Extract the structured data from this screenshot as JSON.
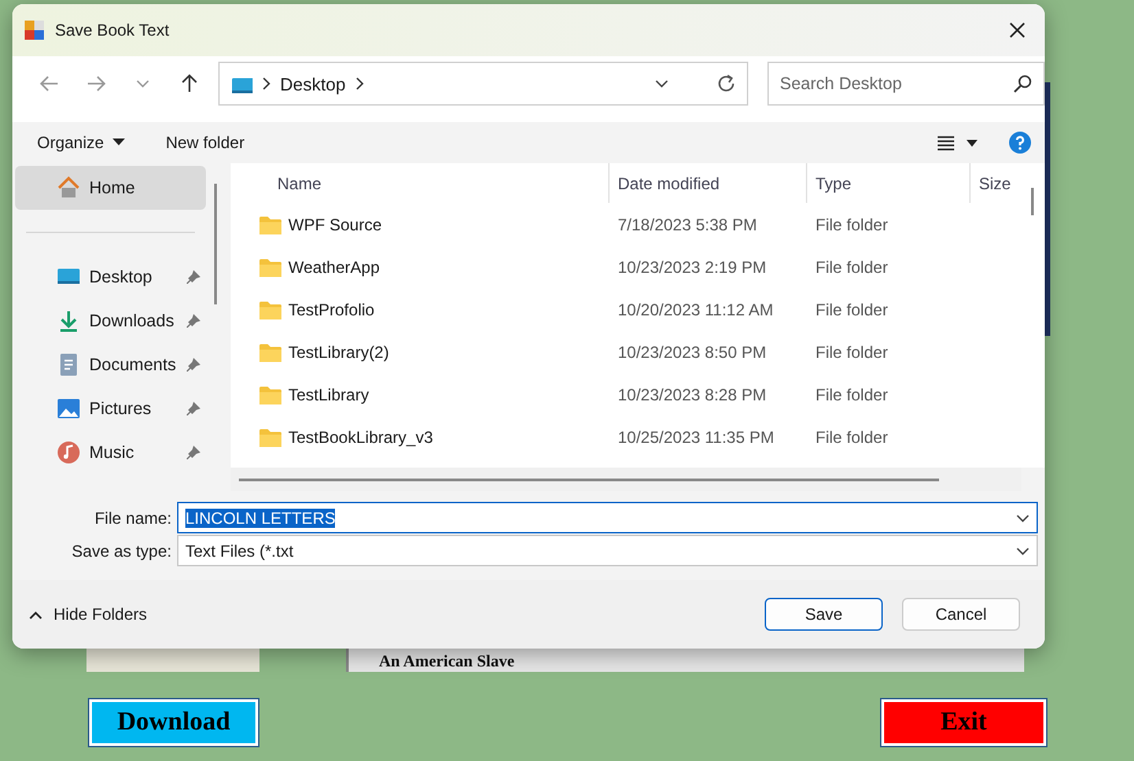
{
  "window": {
    "title": "Save Book Text"
  },
  "address": {
    "path": [
      "Desktop"
    ]
  },
  "search": {
    "placeholder": "Search Desktop"
  },
  "toolbar": {
    "organize": "Organize",
    "new_folder": "New folder"
  },
  "sidebar": {
    "items": [
      {
        "label": "Home",
        "kind": "home",
        "pinned": false,
        "selected": true
      },
      {
        "label": "Desktop",
        "kind": "desktop",
        "pinned": true,
        "selected": false
      },
      {
        "label": "Downloads",
        "kind": "downloads",
        "pinned": true,
        "selected": false
      },
      {
        "label": "Documents",
        "kind": "documents",
        "pinned": true,
        "selected": false
      },
      {
        "label": "Pictures",
        "kind": "pictures",
        "pinned": true,
        "selected": false
      },
      {
        "label": "Music",
        "kind": "music",
        "pinned": true,
        "selected": false
      }
    ]
  },
  "table": {
    "columns": [
      "Name",
      "Date modified",
      "Type",
      "Size"
    ],
    "rows": [
      {
        "name": "WPF Source",
        "date": "7/18/2023 5:38 PM",
        "type": "File folder"
      },
      {
        "name": "WeatherApp",
        "date": "10/23/2023 2:19 PM",
        "type": "File folder"
      },
      {
        "name": "TestProfolio",
        "date": "10/20/2023 11:12 AM",
        "type": "File folder"
      },
      {
        "name": "TestLibrary(2)",
        "date": "10/23/2023 8:50 PM",
        "type": "File folder"
      },
      {
        "name": "TestLibrary",
        "date": "10/23/2023 8:28 PM",
        "type": "File folder"
      },
      {
        "name": "TestBookLibrary_v3",
        "date": "10/25/2023 11:35 PM",
        "type": "File folder"
      }
    ]
  },
  "file_name": {
    "label": "File name:",
    "value": "LINCOLN LETTERS"
  },
  "save_type": {
    "label": "Save as type:",
    "value": "Text Files (*.txt"
  },
  "hide_folders": "Hide Folders",
  "buttons": [
    {
      "label": "Save",
      "default": true
    },
    {
      "label": "Cancel",
      "default": false
    }
  ],
  "background": {
    "caption": "An American Slave",
    "buttons": [
      {
        "label": "Download",
        "kind": "download"
      },
      {
        "label": "Exit",
        "kind": "exit"
      }
    ]
  }
}
